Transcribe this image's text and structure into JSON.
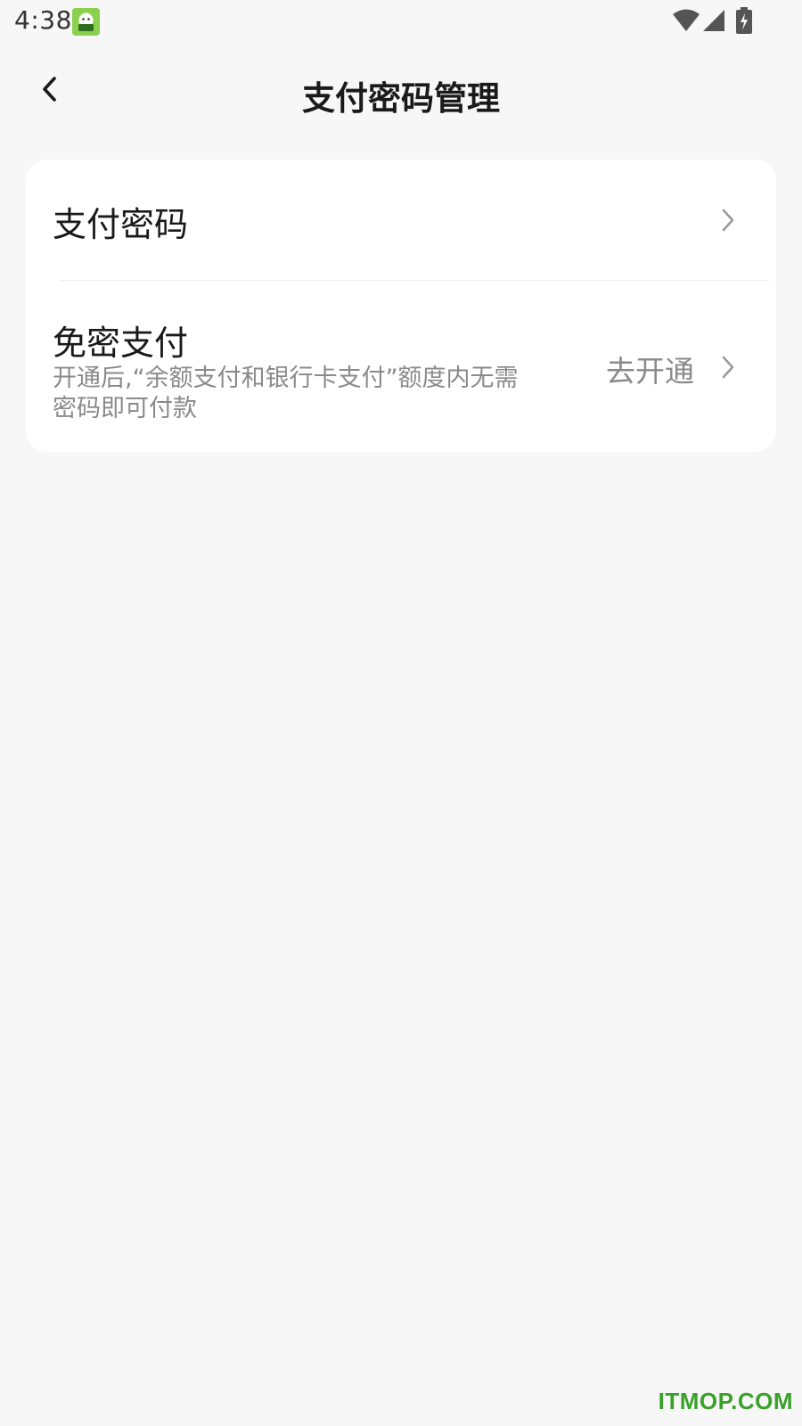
{
  "status_bar": {
    "time": "4:38",
    "icons": [
      "app-notification-icon",
      "wifi-icon",
      "signal-icon",
      "battery-charging-icon"
    ]
  },
  "header": {
    "title": "支付密码管理",
    "back_icon": "chevron-left-icon"
  },
  "settings": {
    "items": [
      {
        "title": "支付密码",
        "icon": "chevron-right-icon"
      },
      {
        "title": "免密支付",
        "description": "开通后,“余额支付和银行卡支付”额度内无需密码即可付款",
        "action": "去开通",
        "icon": "chevron-right-icon"
      }
    ]
  },
  "watermark": "ITMOP.COM",
  "colors": {
    "background": "#f7f7f7",
    "card": "#ffffff",
    "primary_text": "#1a1a1a",
    "secondary_text": "#8a8a8a",
    "watermark": "#3aa12a"
  }
}
